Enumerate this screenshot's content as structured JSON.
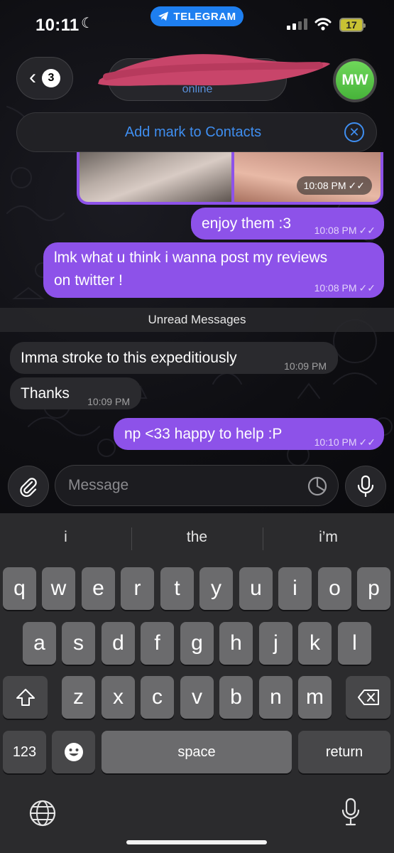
{
  "status_bar": {
    "time": "10:11",
    "focus_icon": "moon-icon",
    "app_pill": "TELEGRAM",
    "battery": "17"
  },
  "header": {
    "back_count": "3",
    "subtitle": "online",
    "avatar_initials": "MW"
  },
  "contact_banner": {
    "label": "Add mark to Contacts"
  },
  "media_message": {
    "time": "10:08 PM"
  },
  "messages": [
    {
      "direction": "outgoing",
      "text": "enjoy them :3",
      "time": "10:08 PM",
      "read": true
    },
    {
      "direction": "outgoing",
      "text_line1": "lmk what u think i wanna post my reviews",
      "text_line2": "on twitter !",
      "time": "10:08 PM",
      "read": true
    },
    {
      "direction": "incoming",
      "text": "Imma stroke to this expeditiously",
      "time": "10:09 PM"
    },
    {
      "direction": "incoming",
      "text": "Thanks",
      "time": "10:09 PM"
    },
    {
      "direction": "outgoing",
      "text": "np <33 happy to help :P",
      "time": "10:10 PM",
      "read": true
    }
  ],
  "unread_divider": "Unread Messages",
  "composer": {
    "placeholder": "Message"
  },
  "keyboard": {
    "suggestions": [
      "i",
      "the",
      "i’m"
    ],
    "row1": [
      "q",
      "w",
      "e",
      "r",
      "t",
      "y",
      "u",
      "i",
      "o",
      "p"
    ],
    "row2": [
      "a",
      "s",
      "d",
      "f",
      "g",
      "h",
      "j",
      "k",
      "l"
    ],
    "row3": [
      "z",
      "x",
      "c",
      "v",
      "b",
      "n",
      "m"
    ],
    "numbers_key": "123",
    "space_key": "space",
    "return_key": "return"
  },
  "colors": {
    "outgoing_bubble": "#8d52e9",
    "incoming_bubble": "#2a2a2e",
    "accent_blue": "#3f8ef0",
    "telegram_pill": "#1e7ff0",
    "avatar_green": "#5ac84a"
  }
}
